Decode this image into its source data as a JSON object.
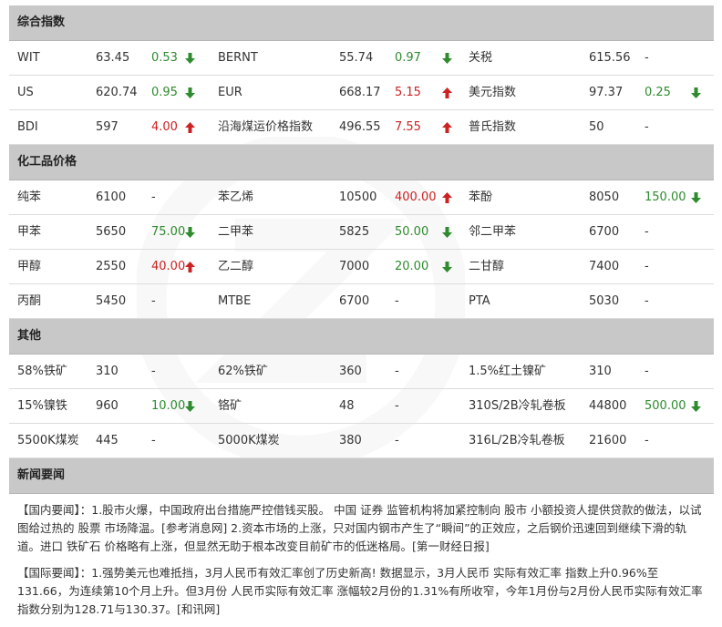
{
  "colors": {
    "up": "#cc2222",
    "down": "#2e8b2e",
    "header_bg": "#c8c8c8"
  },
  "sections": {
    "composite": {
      "title": "综合指数",
      "rows": [
        [
          {
            "name": "WIT",
            "value": "63.45",
            "change": "0.53",
            "dir": "down"
          },
          {
            "name": "BERNT",
            "value": "55.74",
            "change": "0.97",
            "dir": "down"
          },
          {
            "name": "关税",
            "value": "615.56",
            "change": "-",
            "dir": "none"
          }
        ],
        [
          {
            "name": "US",
            "value": "620.74",
            "change": "0.95",
            "dir": "down"
          },
          {
            "name": "EUR",
            "value": "668.17",
            "change": "5.15",
            "dir": "up"
          },
          {
            "name": "美元指数",
            "value": "97.37",
            "change": "0.25",
            "dir": "down"
          }
        ],
        [
          {
            "name": "BDI",
            "value": "597",
            "change": "4.00",
            "dir": "up"
          },
          {
            "name": "沿海煤运价格指数",
            "value": "496.55",
            "change": "7.55",
            "dir": "up"
          },
          {
            "name": "普氏指数",
            "value": "50",
            "change": "-",
            "dir": "none"
          }
        ]
      ]
    },
    "chemicals": {
      "title": "化工品价格",
      "rows": [
        [
          {
            "name": "纯苯",
            "value": "6100",
            "change": "-",
            "dir": "none"
          },
          {
            "name": "苯乙烯",
            "value": "10500",
            "change": "400.00",
            "dir": "up"
          },
          {
            "name": "苯酚",
            "value": "8050",
            "change": "150.00",
            "dir": "down"
          }
        ],
        [
          {
            "name": "甲苯",
            "value": "5650",
            "change": "75.00",
            "dir": "down"
          },
          {
            "name": "二甲苯",
            "value": "5825",
            "change": "50.00",
            "dir": "down"
          },
          {
            "name": "邻二甲苯",
            "value": "6700",
            "change": "-",
            "dir": "none"
          }
        ],
        [
          {
            "name": "甲醇",
            "value": "2550",
            "change": "40.00",
            "dir": "up"
          },
          {
            "name": "乙二醇",
            "value": "7000",
            "change": "20.00",
            "dir": "down"
          },
          {
            "name": "二甘醇",
            "value": "7400",
            "change": "-",
            "dir": "none"
          }
        ],
        [
          {
            "name": "丙酮",
            "value": "5450",
            "change": "-",
            "dir": "none"
          },
          {
            "name": "MTBE",
            "value": "6700",
            "change": "-",
            "dir": "none"
          },
          {
            "name": "PTA",
            "value": "5030",
            "change": "-",
            "dir": "none"
          }
        ]
      ]
    },
    "other": {
      "title": "其他",
      "rows": [
        [
          {
            "name": "58%铁矿",
            "value": "310",
            "change": "-",
            "dir": "none"
          },
          {
            "name": "62%铁矿",
            "value": "360",
            "change": "-",
            "dir": "none"
          },
          {
            "name": "1.5%红土镍矿",
            "value": "310",
            "change": "-",
            "dir": "none"
          }
        ],
        [
          {
            "name": "15%镍铁",
            "value": "960",
            "change": "10.00",
            "dir": "down"
          },
          {
            "name": "铬矿",
            "value": "48",
            "change": "-",
            "dir": "none"
          },
          {
            "name": "310S/2B冷轧卷板",
            "value": "44800",
            "change": "500.00",
            "dir": "down"
          }
        ],
        [
          {
            "name": "5500K煤炭",
            "value": "445",
            "change": "-",
            "dir": "none"
          },
          {
            "name": "5000K煤炭",
            "value": "380",
            "change": "-",
            "dir": "none"
          },
          {
            "name": "316L/2B冷轧卷板",
            "value": "21600",
            "change": "-",
            "dir": "none"
          }
        ]
      ]
    }
  },
  "news": {
    "title": "新闻要闻",
    "items": [
      "【国内要闻】：1.股市火爆，中国政府出台措施严控借钱买股。 中国 证券 监管机构将加紧控制向 股市 小额投资人提供贷款的做法，以试图给过热的 股票 市场降温。[参考消息网] 2.资本市场的上涨，只对国内钢市产生了“瞬间”的正效应，之后钢价迅速回到继续下滑的轨道。进口 铁矿石 价格略有上涨，但显然无助于根本改变目前矿市的低迷格局。[第一财经日报]",
      "【国际要闻】：1.强势美元也难抵挡，3月人民币有效汇率创了历史新高! 数据显示，3月人民币 实际有效汇率 指数上升0.96%至131.66，为连续第10个月上升。但3月份 人民币实际有效汇率 涨幅较2月份的1.31%有所收窄，今年1月份与2月份人民币实际有效汇率指数分别为128.71与130.37。[和讯网]"
    ]
  }
}
